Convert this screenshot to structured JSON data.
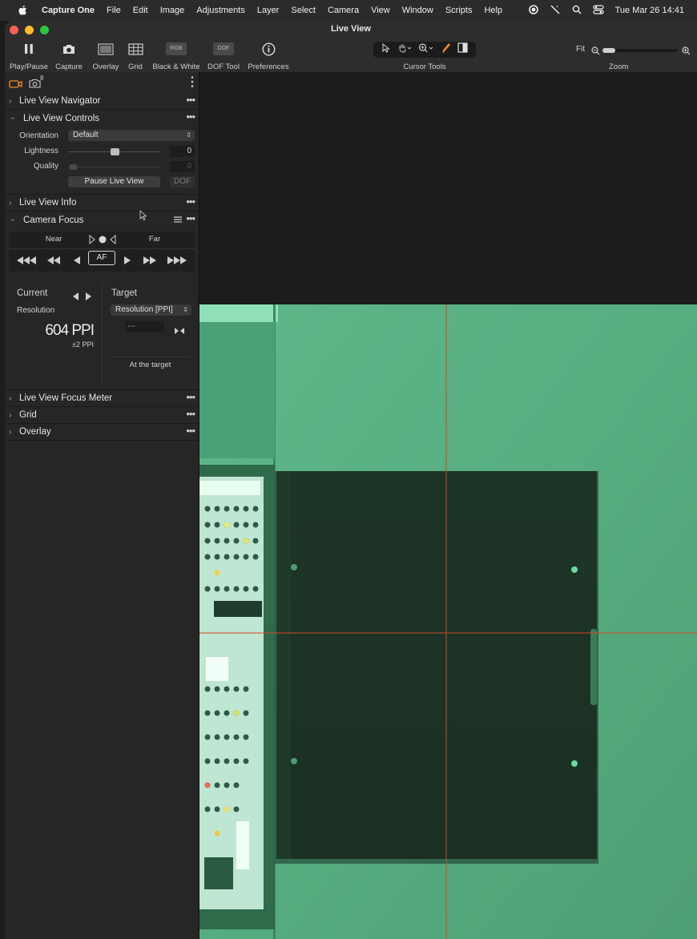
{
  "menubar": {
    "app": "Capture One",
    "items": [
      "File",
      "Edit",
      "Image",
      "Adjustments",
      "Layer",
      "Select",
      "Camera",
      "View",
      "Window",
      "Scripts",
      "Help"
    ],
    "datetime": "Tue Mar 26  14:41"
  },
  "window": {
    "title": "Live View"
  },
  "toolbar": {
    "play_pause": "Play/Pause",
    "capture": "Capture",
    "overlay": "Overlay",
    "grid": "Grid",
    "bw": "Black & White",
    "bw_icon_text": "RGB",
    "dof": "DOF Tool",
    "dof_icon_text": "DOF",
    "preferences": "Preferences",
    "cursor_tools": "Cursor Tools",
    "zoom_fit": "Fit",
    "zoom": "Zoom",
    "zoom_level": 0.0
  },
  "sidebar": {
    "camera_badge": "8",
    "sections": {
      "navigator": "Live View Navigator",
      "controls": "Live View Controls",
      "info": "Live View Info",
      "focus": "Camera Focus",
      "focus_meter": "Live View Focus Meter",
      "grid": "Grid",
      "overlay": "Overlay"
    },
    "controls": {
      "orientation_label": "Orientation",
      "orientation_value": "Default",
      "lightness_label": "Lightness",
      "lightness_value": "0",
      "lightness_level": 0.5,
      "quality_label": "Quality",
      "quality_value": "0",
      "pause_button": "Pause Live View",
      "dof_button": "DOF"
    },
    "focus": {
      "near": "Near",
      "far": "Far",
      "af": "AF",
      "current": "Current",
      "target": "Target",
      "resolution_label": "Resolution",
      "target_select": "Resolution [PPI]",
      "target_input": "---",
      "value": "604 PPI",
      "tolerance": "±2 PPI",
      "at_target": "At the target"
    }
  }
}
